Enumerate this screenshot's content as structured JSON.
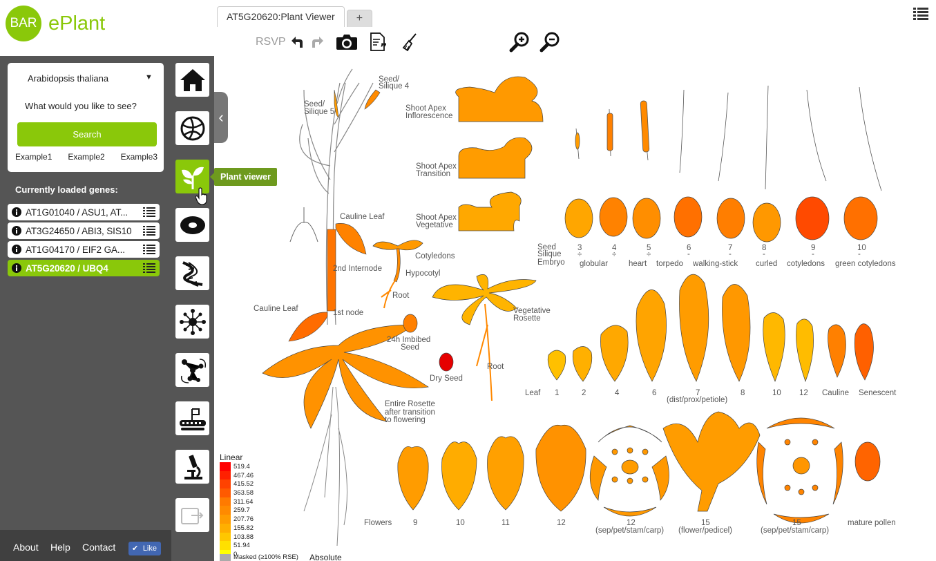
{
  "header": {
    "logo_text": "BAR",
    "app_name": "ePlant",
    "tabs": [
      {
        "label": "AT5G20620:Plant Viewer"
      },
      {
        "label": "+"
      }
    ]
  },
  "toolbar": {
    "rsvp_label": "RSVP"
  },
  "sidebar": {
    "species": "Arabidopsis thaliana",
    "species_arrow": "▼",
    "prompt": "What would you like to see?",
    "search_label": "Search",
    "examples": [
      "Example1",
      "Example2",
      "Example3"
    ],
    "loaded_title": "Currently loaded genes:",
    "genes": [
      {
        "label": "AT1G01040 / ASU1, AT..."
      },
      {
        "label": "AT3G24650 / ABI3, SIS10"
      },
      {
        "label": "AT1G04170 / EIF2 GA..."
      },
      {
        "label": "AT5G20620 / UBQ4"
      }
    ],
    "footer": {
      "about": "About",
      "help": "Help",
      "contact": "Contact",
      "like": "Like"
    }
  },
  "nav": {
    "items": [
      {
        "icon": "home-icon"
      },
      {
        "icon": "world-icon"
      },
      {
        "icon": "plant-icon"
      },
      {
        "icon": "cell-icon"
      },
      {
        "icon": "dna-icon"
      },
      {
        "icon": "interaction-icon"
      },
      {
        "icon": "molecule-icon"
      },
      {
        "icon": "chromosome-icon"
      },
      {
        "icon": "microscope-icon"
      },
      {
        "icon": "export-icon"
      }
    ],
    "tooltip": "Plant viewer"
  },
  "viewer": {
    "labels": {
      "seed_silique4": [
        "Seed/",
        "Silique 4"
      ],
      "seed_silique5": [
        "Seed/",
        "Silique 5"
      ],
      "apex_inflor": [
        "Shoot Apex",
        "Inflorescence"
      ],
      "apex_trans": [
        "Shoot Apex",
        "Transition"
      ],
      "apex_veg": [
        "Shoot Apex",
        "Vegetative"
      ],
      "cauline_leaf_top": "Cauline Leaf",
      "internode": "2nd Internode",
      "cauline_leaf_left": "Cauline Leaf",
      "first_node": "1st node",
      "cotyledons": "Cotyledons",
      "hypocotyl": "Hypocotyl",
      "root1": "Root",
      "veg_rosette": [
        "Vegetative",
        "Rosette"
      ],
      "imbibed": [
        "24h Imbibed",
        "Seed"
      ],
      "dry_seed": "Dry Seed",
      "root2": "Root",
      "rosette_after": [
        "Entire Rosette",
        "after transition",
        "to flowering"
      ]
    },
    "embryo_row": {
      "header": [
        "Seed",
        "Silique",
        "Embryo"
      ],
      "numbers": [
        "3",
        "4",
        "5",
        "6",
        "7",
        "8",
        "9",
        "10"
      ],
      "marks": [
        "÷",
        "÷",
        "÷",
        "-",
        "-",
        "-",
        "-",
        "-"
      ],
      "stages": [
        "globular",
        "heart",
        "torpedo",
        "walking-stick",
        "curled",
        "cotyledons",
        "green cotyledons"
      ]
    },
    "leaf_row": {
      "header": "Leaf",
      "items": [
        "1",
        "2",
        "4",
        "6",
        "7",
        "8",
        "10",
        "12",
        "Cauline",
        "Senescent"
      ],
      "sub7": "(dist/prox/petiole)"
    },
    "flower_row": {
      "header": "Flowers",
      "items": [
        "9",
        "10",
        "11",
        "12",
        "12",
        "15",
        "15",
        "mature pollen"
      ],
      "subs": [
        "(sep/pet/stam/carp)",
        "(flower/pedicel)",
        "(sep/pet/stam/carp)"
      ]
    }
  },
  "legend": {
    "title": "Linear",
    "values": [
      "519.4",
      "467.46",
      "415.52",
      "363.58",
      "311.64",
      "259.7",
      "207.76",
      "155.82",
      "103.88",
      "51.94",
      "0"
    ],
    "colors": [
      "#ff0000",
      "#ff2000",
      "#ff4200",
      "#ff5a00",
      "#ff7a00",
      "#ff8a00",
      "#ff9c00",
      "#ffaf00",
      "#ffc700",
      "#ffe000",
      "#ffff00"
    ],
    "masked_label": "Masked (≥100% RSE)",
    "mode": "Absolute"
  },
  "colors": {
    "accent": "#8ac80a",
    "panel": "#555555"
  }
}
